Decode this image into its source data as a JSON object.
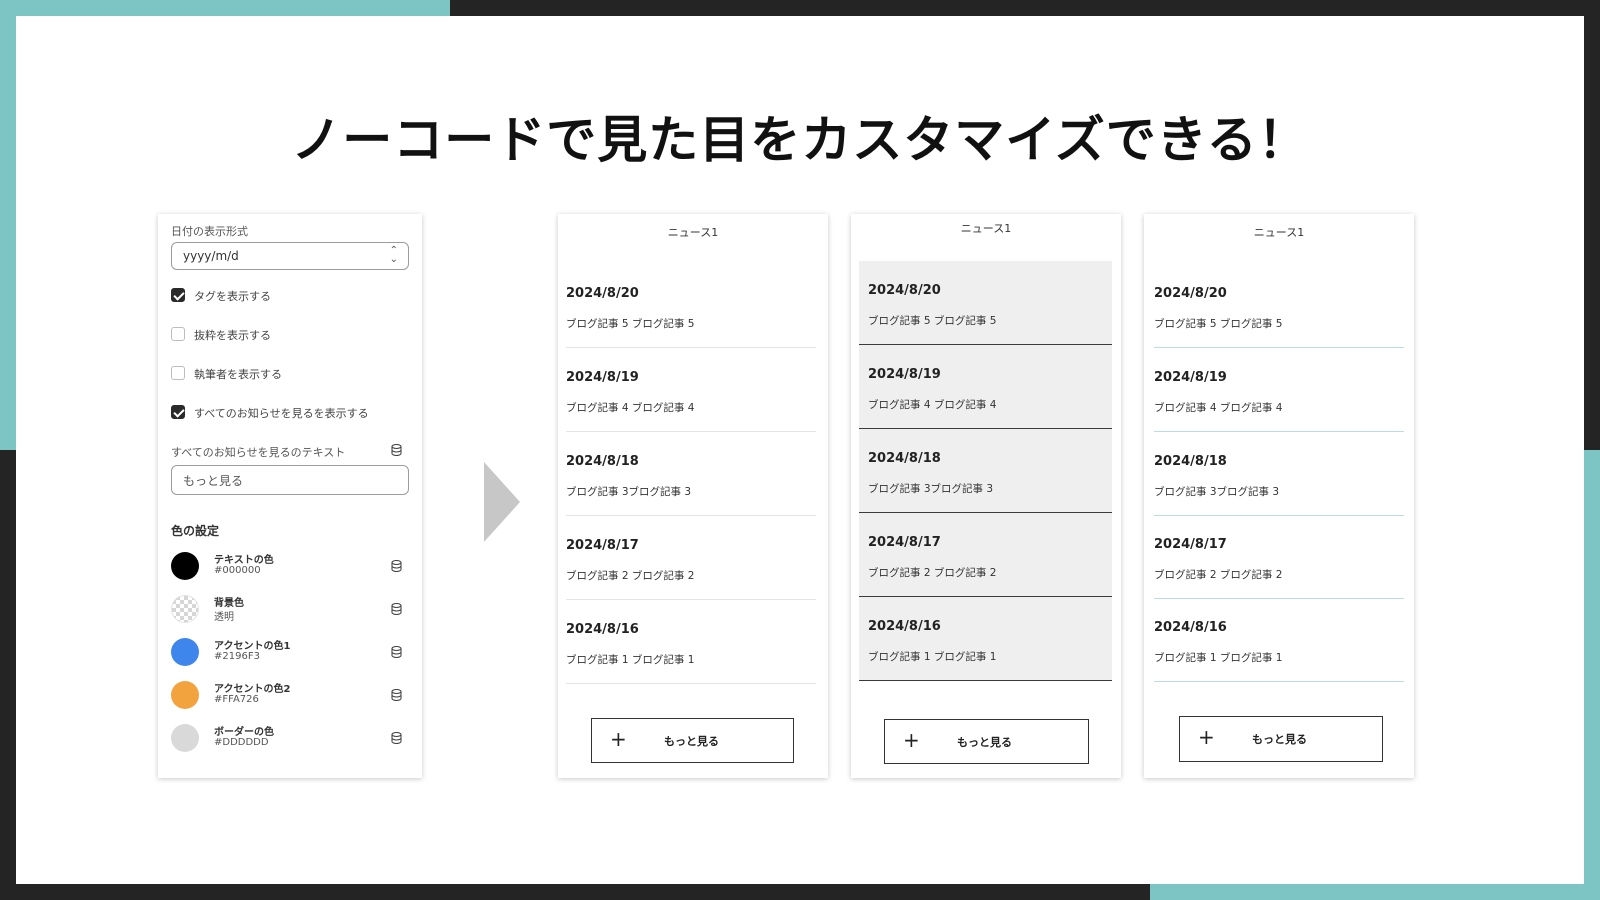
{
  "headline": "ノーコードで見た目をカスタマイズできる！",
  "settings": {
    "date_format_label": "日付の表示形式",
    "date_format_value": "yyyy/m/d",
    "checkboxes": [
      {
        "label": "タグを表示する",
        "checked": true
      },
      {
        "label": "抜粋を表示する",
        "checked": false
      },
      {
        "label": "執筆者を表示する",
        "checked": false
      },
      {
        "label": "すべてのお知らせを見るを表示する",
        "checked": true
      }
    ],
    "see_all_text_label": "すべてのお知らせを見るのテキスト",
    "see_all_text_value": "もっと見る",
    "color_heading": "色の設定",
    "colors": [
      {
        "name": "テキストの色",
        "value": "#000000",
        "swatch": "#000000"
      },
      {
        "name": "背景色",
        "value": "透明",
        "swatch": "transparent"
      },
      {
        "name": "アクセントの色1",
        "value": "#2196F3",
        "swatch": "#3f86ec"
      },
      {
        "name": "アクセントの色2",
        "value": "#FFA726",
        "swatch": "#f3a33e"
      },
      {
        "name": "ボーダーの色",
        "value": "#DDDDDD",
        "swatch": "#d9d9d9"
      }
    ]
  },
  "previews": [
    {
      "title": "ニュース1",
      "items": [
        {
          "date": "2024/8/20",
          "text": "ブログ記事 5 ブログ記事 5"
        },
        {
          "date": "2024/8/19",
          "text": "ブログ記事 4 ブログ記事 4"
        },
        {
          "date": "2024/8/18",
          "text": "ブログ記事 3ブログ記事 3"
        },
        {
          "date": "2024/8/17",
          "text": "ブログ記事 2 ブログ記事 2"
        },
        {
          "date": "2024/8/16",
          "text": "ブログ記事 1 ブログ記事 1"
        }
      ],
      "button": "もっと見る"
    },
    {
      "title": "ニュース1",
      "items": [
        {
          "date": "2024/8/20",
          "text": "ブログ記事 5 ブログ記事 5"
        },
        {
          "date": "2024/8/19",
          "text": "ブログ記事 4 ブログ記事 4"
        },
        {
          "date": "2024/8/18",
          "text": "ブログ記事 3ブログ記事 3"
        },
        {
          "date": "2024/8/17",
          "text": "ブログ記事 2 ブログ記事 2"
        },
        {
          "date": "2024/8/16",
          "text": "ブログ記事 1 ブログ記事 1"
        }
      ],
      "button": "もっと見る"
    },
    {
      "title": "ニュース1",
      "items": [
        {
          "date": "2024/8/20",
          "text": "ブログ記事 5 ブログ記事 5"
        },
        {
          "date": "2024/8/19",
          "text": "ブログ記事 4 ブログ記事 4"
        },
        {
          "date": "2024/8/18",
          "text": "ブログ記事 3ブログ記事 3"
        },
        {
          "date": "2024/8/17",
          "text": "ブログ記事 2 ブログ記事 2"
        },
        {
          "date": "2024/8/16",
          "text": "ブログ記事 1 ブログ記事 1"
        }
      ],
      "button": "もっと見る"
    }
  ]
}
